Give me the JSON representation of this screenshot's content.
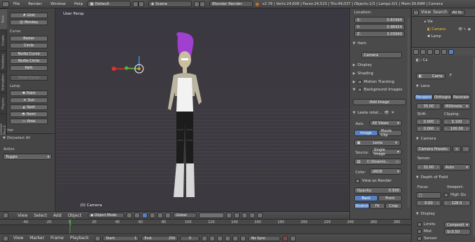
{
  "topbar": {
    "menus": [
      "File",
      "Render",
      "Window",
      "Help"
    ],
    "layout": "Default",
    "scene": "Scene",
    "engine": "Blender Render",
    "stats": "v2.78 | Verts:24,608 | Faces:24,523 | Tris:49,037 | Objects:1/3 | Lamps:0/1 | Mem:39.69M | Camera"
  },
  "left_tabs": [
    "Tools",
    "Create",
    "Relations",
    "Animation",
    "Physics",
    "Grease Pencil"
  ],
  "left_panel": {
    "buttons_top": [
      "Grid",
      "Monkey"
    ],
    "curve_label": "Curve:",
    "curve_buttons": [
      "Bezier",
      "Circle",
      "Nurbs Curve",
      "Nurbs Circle",
      "Path",
      "Draw Curve"
    ],
    "lamp_label": "Lamp:",
    "lamp_buttons": [
      "Point",
      "Sun",
      "Spot",
      "Hemi",
      "Area"
    ],
    "other_label": "Other",
    "deselect_label": "(De)select All",
    "action_label": "Action",
    "action_value": "Toggle"
  },
  "viewport": {
    "label": "User Persp",
    "camera_label": "(0) Camera"
  },
  "npanel": {
    "location_label": "Location:",
    "x_label": "X:",
    "x_value": "0.83494",
    "y_label": "Y:",
    "y_value": "0.98424",
    "z_label": "Z:",
    "z_value": "3.03940",
    "item_label": "Item",
    "item_name": "Camera",
    "display_label": "Display",
    "shading_label": "Shading",
    "motion_label": "Motion Tracking",
    "bg_label": "Background Images",
    "add_image": "Add Image",
    "image_name": "Leela rotat...",
    "axis_label": "Axis:",
    "axis_value": "All Views",
    "image_tab": "Image",
    "movie_tab": "Movie Clip",
    "leela_field": "Leela",
    "source_label": "Source:",
    "source_value": "Single Image",
    "path_value": "C:\\Downlo...",
    "color_label": "Color:",
    "color_value": "sRGB",
    "view_render": "View as Render",
    "opacity_label": "Opacity:",
    "opacity_value": "0.500",
    "back": "Back",
    "front": "Front",
    "stretch": "Stretch",
    "fit": "Fit",
    "crop": "Crop"
  },
  "rpanel": {
    "view_label": "View",
    "search_label": "Search",
    "all_scenes": "All Sc",
    "outliner": [
      "Vie",
      "Camera",
      "Lamp"
    ],
    "ca_label": "Ca",
    "camera_field": "Came",
    "f_label": "F",
    "lens_label": "Lens",
    "persp": "Perspect",
    "ortho": "Orthogra",
    "panorama": "Panoram",
    "focal": "35.00",
    "mm": "Millimete",
    "shift_label": "Shift:",
    "clipping_label": "Clipping:",
    "shift_x": "0.000",
    "shift_y": "0.000",
    "clip_start": "0.100",
    "clip_end": "100.00",
    "camera_label": "Camera",
    "presets": "Camera Presets",
    "sensor_label": "Sensor:",
    "sensor_value": "32.00",
    "auto": "Auto",
    "dof_label": "Depth of Field",
    "focus_label": "Focus:",
    "viewport_label": "Viewport:",
    "high_q": "High Qu",
    "dist_value": "0.00",
    "fstop_value": "128.0",
    "display_label": "Display",
    "limits": "Limits",
    "composit": "Composit",
    "mist": "Mist",
    "sensor_chk": "Sensor",
    "sensor_size": "Si:0.50"
  },
  "view_toolbar": {
    "items": [
      "View",
      "Select",
      "Add",
      "Object"
    ],
    "mode": "Object Mode",
    "pivot": "Global"
  },
  "timeline": {
    "ticks": [
      "-40",
      "-20",
      "0",
      "20",
      "40",
      "60",
      "80",
      "100",
      "120",
      "140",
      "160",
      "180",
      "200",
      "220",
      "240",
      "260",
      "280"
    ],
    "menus": [
      "View",
      "Marker",
      "Frame",
      "Playback"
    ],
    "start_label": "Start:",
    "start_value": "1",
    "end_label": "End:",
    "end_value": "250",
    "frame_value": "0",
    "sync": "No Sync"
  },
  "colors": {
    "accent": "#5680c2",
    "hair": "#a040d0"
  }
}
